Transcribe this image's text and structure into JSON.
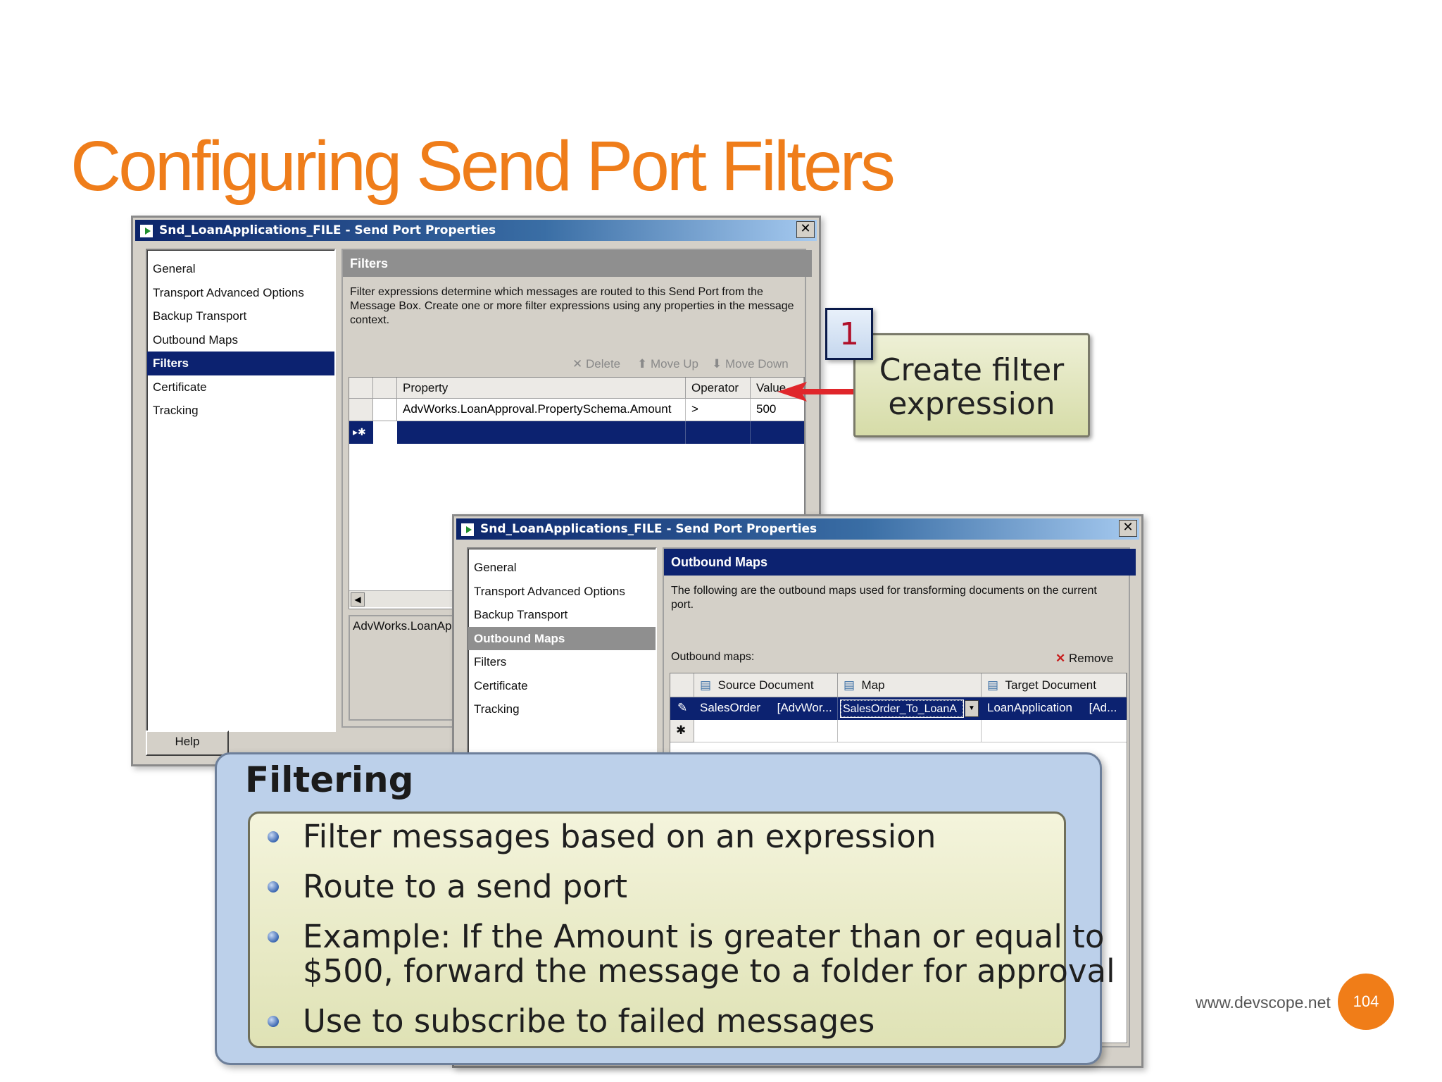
{
  "slide": {
    "title": "Configuring Send Port Filters",
    "footer_url": "www.devscope.net",
    "page_number": "104"
  },
  "window_back": {
    "title": "Snd_LoanApplications_FILE - Send Port Properties",
    "nav": [
      "General",
      "Transport Advanced Options",
      "Backup Transport",
      "Outbound Maps",
      "Filters",
      "Certificate",
      "Tracking"
    ],
    "selected_nav": "Filters",
    "section_title": "Filters",
    "description": "Filter expressions determine which messages are routed to this Send Port from the Message Box. Create one or more filter expressions using any properties in the message context.",
    "toolbar": {
      "delete": "Delete",
      "move_up": "Move Up",
      "move_down": "Move Down"
    },
    "columns": [
      "Property",
      "Operator",
      "Value"
    ],
    "rows": [
      {
        "property": "AdvWorks.LoanApproval.PropertySchema.Amount",
        "operator": ">",
        "value": "500"
      }
    ],
    "new_row_marker": "▸✱",
    "expression_preview": "AdvWorks.LoanApp",
    "help_button": "Help"
  },
  "window_front": {
    "title": "Snd_LoanApplications_FILE - Send Port Properties",
    "nav": [
      "General",
      "Transport Advanced Options",
      "Backup Transport",
      "Outbound Maps",
      "Filters",
      "Certificate",
      "Tracking"
    ],
    "selected_nav": "Outbound Maps",
    "section_title": "Outbound Maps",
    "description": "The following are the outbound maps used for transforming documents on the current port.",
    "list_label": "Outbound maps:",
    "remove_button": "Remove",
    "columns": [
      "Source Document",
      "Map",
      "Target Document"
    ],
    "rows": [
      {
        "source": "SalesOrder",
        "source_ns": "[AdvWor...",
        "map": "SalesOrder_To_LoanA",
        "target": "LoanApplication",
        "target_ns": "[Ad..."
      }
    ],
    "new_row_marker": "✱"
  },
  "callout": {
    "number": "1",
    "text_line1": "Create filter",
    "text_line2": "expression"
  },
  "filtering": {
    "title": "Filtering",
    "bullets": [
      "Filter messages based on an expression",
      "Route to a send port",
      "Example: If the Amount is greater than or equal to",
      "$500, forward the message to a folder for approval",
      "Use to subscribe to failed messages"
    ]
  },
  "colors": {
    "title_orange": "#ef7d1a",
    "selection_navy": "#0c2270",
    "arrow_red": "#e0262b",
    "panel_blue": "#bcd0ea"
  }
}
